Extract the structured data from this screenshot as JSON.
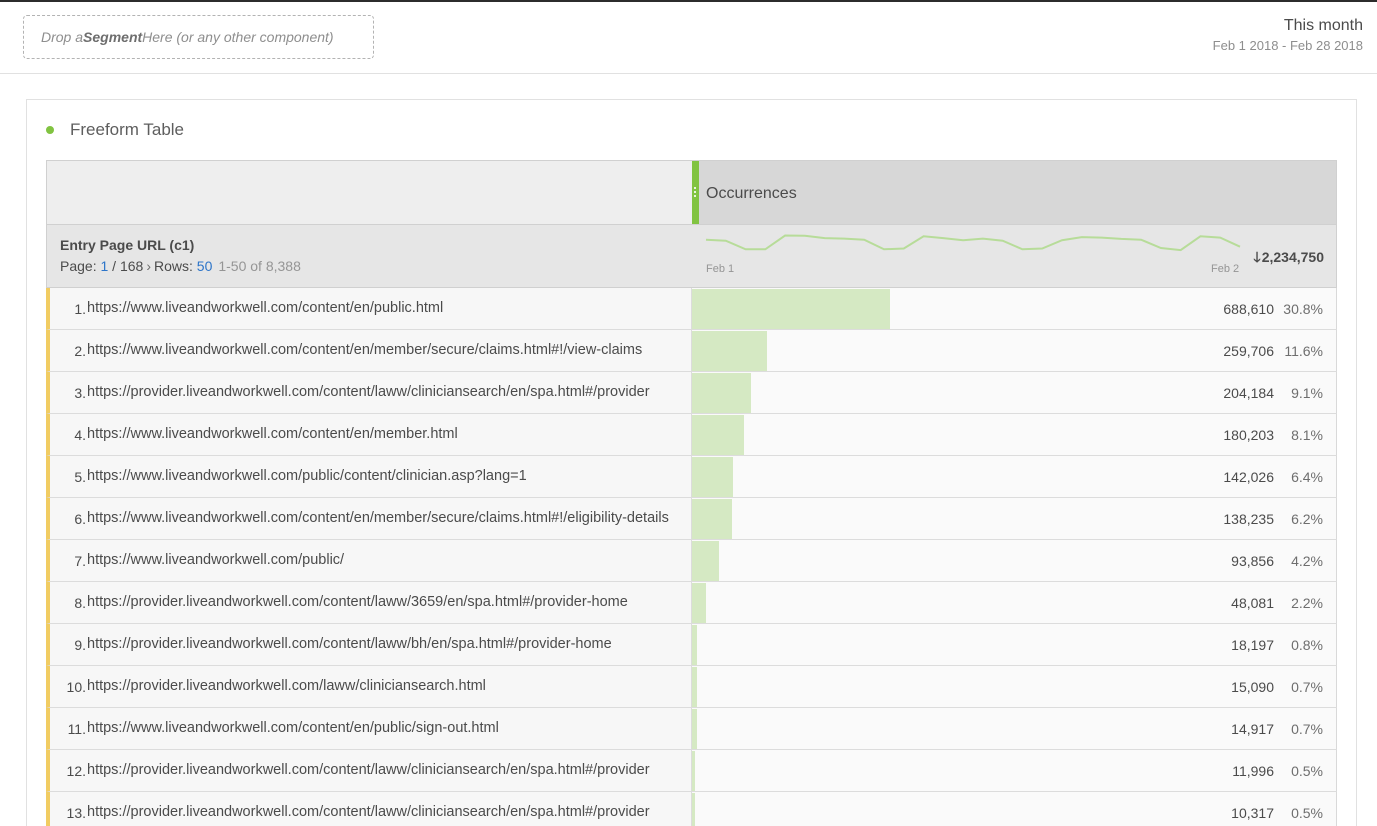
{
  "segment": {
    "drop_prefix": "Drop a ",
    "drop_bold": "Segment",
    "drop_suffix": " Here (or any other component)"
  },
  "date": {
    "title": "This month",
    "range": "Feb 1 2018 - Feb 28 2018"
  },
  "panel": {
    "viz_title": "Freeform Table",
    "viz_status_color": "#81c341",
    "metric_label": "Occurrences",
    "dimension": {
      "title": "Entry Page URL (c1)",
      "page_label": "Page: ",
      "page_current": "1",
      "page_total": " / 168",
      "rows_label": "Rows: ",
      "rows_value": "50",
      "range": "1-50 of 8,388",
      "total": "2,234,750",
      "spark_start": "Feb 1",
      "spark_end": "Feb 2",
      "spark_values": [
        0.82,
        0.78,
        0.45,
        0.45,
        0.98,
        0.97,
        0.88,
        0.86,
        0.82,
        0.45,
        0.48,
        0.95,
        0.88,
        0.8,
        0.86,
        0.78,
        0.45,
        0.48,
        0.8,
        0.92,
        0.9,
        0.85,
        0.82,
        0.5,
        0.42,
        0.95,
        0.9,
        0.55
      ]
    },
    "rows": [
      {
        "n": "1.",
        "url": "https://www.liveandworkwell.com/content/en/public.html",
        "value": "688,610",
        "pct": "30.8%",
        "share": 0.308
      },
      {
        "n": "2.",
        "url": "https://www.liveandworkwell.com/content/en/member/secure/claims.html#!/view-claims",
        "value": "259,706",
        "pct": "11.6%",
        "share": 0.116
      },
      {
        "n": "3.",
        "url": "https://provider.liveandworkwell.com/content/laww/cliniciansearch/en/spa.html#/provider",
        "value": "204,184",
        "pct": "9.1%",
        "share": 0.091
      },
      {
        "n": "4.",
        "url": "https://www.liveandworkwell.com/content/en/member.html",
        "value": "180,203",
        "pct": "8.1%",
        "share": 0.081
      },
      {
        "n": "5.",
        "url": "https://www.liveandworkwell.com/public/content/clinician.asp?lang=1",
        "value": "142,026",
        "pct": "6.4%",
        "share": 0.064
      },
      {
        "n": "6.",
        "url": "https://www.liveandworkwell.com/content/en/member/secure/claims.html#!/eligibility-details",
        "value": "138,235",
        "pct": "6.2%",
        "share": 0.062
      },
      {
        "n": "7.",
        "url": "https://www.liveandworkwell.com/public/",
        "value": "93,856",
        "pct": "4.2%",
        "share": 0.042
      },
      {
        "n": "8.",
        "url": "https://provider.liveandworkwell.com/content/laww/3659/en/spa.html#/provider-home",
        "value": "48,081",
        "pct": "2.2%",
        "share": 0.022
      },
      {
        "n": "9.",
        "url": "https://provider.liveandworkwell.com/content/laww/bh/en/spa.html#/provider-home",
        "value": "18,197",
        "pct": "0.8%",
        "share": 0.008
      },
      {
        "n": "10.",
        "url": "https://provider.liveandworkwell.com/laww/cliniciansearch.html",
        "value": "15,090",
        "pct": "0.7%",
        "share": 0.007
      },
      {
        "n": "11.",
        "url": "https://www.liveandworkwell.com/content/en/public/sign-out.html",
        "value": "14,917",
        "pct": "0.7%",
        "share": 0.007
      },
      {
        "n": "12.",
        "url": "https://provider.liveandworkwell.com/content/laww/cliniciansearch/en/spa.html#/provider",
        "value": "11,996",
        "pct": "0.5%",
        "share": 0.005
      },
      {
        "n": "13.",
        "url": "https://provider.liveandworkwell.com/content/laww/cliniciansearch/en/spa.html#/provider",
        "value": "10,317",
        "pct": "0.5%",
        "share": 0.005
      }
    ]
  }
}
